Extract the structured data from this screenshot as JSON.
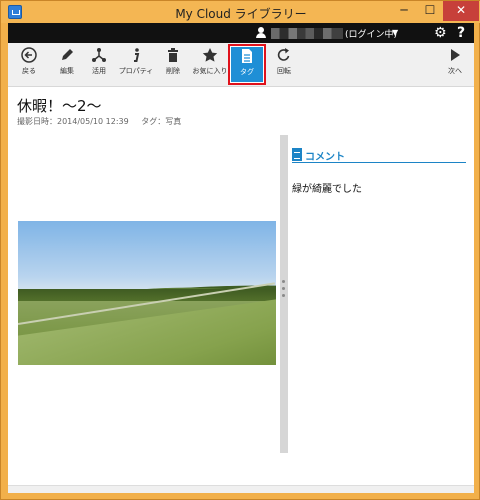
{
  "window": {
    "title": "My Cloud ライブラリー",
    "minimize": "─",
    "maximize": "☐",
    "close": "✕"
  },
  "header": {
    "login_status": "(ログイン中)",
    "dropdown_icon": "caret-down-icon",
    "settings_icon": "gear-icon",
    "help_icon": "help-icon"
  },
  "toolbar": {
    "items": [
      {
        "label": "戻る",
        "icon": "back-icon"
      },
      {
        "label": "編集",
        "icon": "edit-icon"
      },
      {
        "label": "活用",
        "icon": "share-icon"
      },
      {
        "label": "プロパティ",
        "icon": "info-icon"
      },
      {
        "label": "削除",
        "icon": "trash-icon"
      },
      {
        "label": "お気に入り",
        "icon": "star-icon"
      },
      {
        "label": "タグ",
        "icon": "tag-icon",
        "active": true
      },
      {
        "label": "回転",
        "icon": "rotate-icon"
      },
      {
        "label": "次へ",
        "icon": "next-icon"
      }
    ],
    "accent": "#1f8fd6",
    "highlight": "#e0121c"
  },
  "photo": {
    "title": "休暇！～2～",
    "taken_label": "撮影日時：2014/05/10 12:39",
    "tag_label": "タグ：写真"
  },
  "comment": {
    "header": "コメント",
    "text": "緑が綺麗でした",
    "accent": "#1c84c6"
  }
}
